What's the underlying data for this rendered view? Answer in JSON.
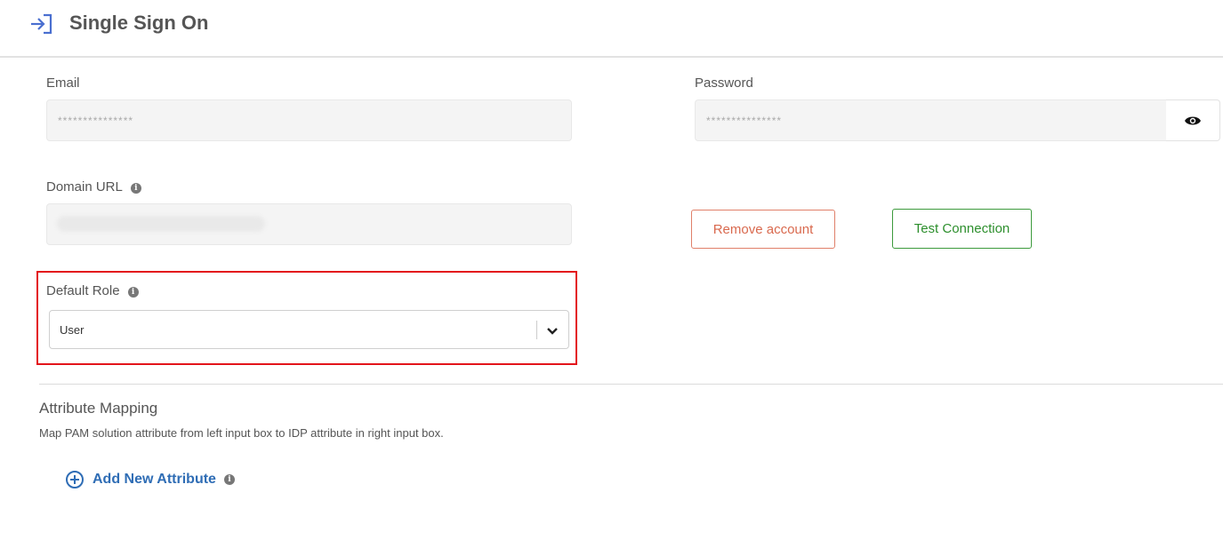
{
  "header": {
    "title": "Single Sign On",
    "icon": "sign-in-icon"
  },
  "form": {
    "email": {
      "label": "Email",
      "value": "***************"
    },
    "password": {
      "label": "Password",
      "value": "***************",
      "toggle_icon": "eye-icon"
    },
    "domain_url": {
      "label": "Domain URL",
      "info_icon": "info-icon"
    },
    "default_role": {
      "label": "Default Role",
      "value": "User",
      "info_icon": "info-icon"
    }
  },
  "actions": {
    "remove_account": "Remove account",
    "test_connection": "Test Connection"
  },
  "attribute_mapping": {
    "title": "Attribute Mapping",
    "description": "Map PAM solution attribute from left input box to IDP attribute in right input box.",
    "add_label": "Add New Attribute"
  },
  "colors": {
    "accent_blue": "#2f6db5",
    "remove_red": "#d9694e",
    "test_green": "#2d8f2d",
    "highlight_red": "#e3141b"
  }
}
